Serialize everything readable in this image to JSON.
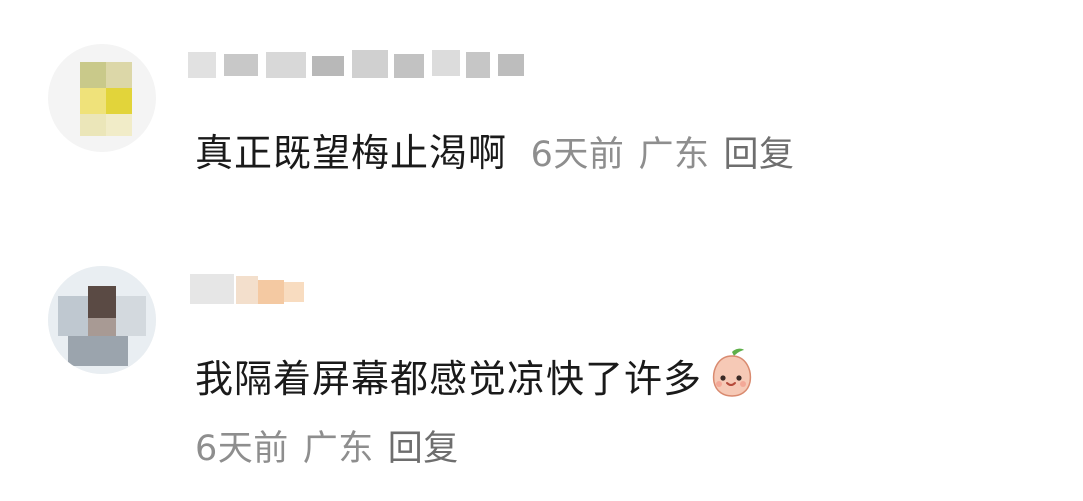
{
  "comments": [
    {
      "text": "真正既望梅止渴啊",
      "time": "6天前",
      "location": "广东",
      "reply_label": "回复"
    },
    {
      "text": "我隔着屏幕都感觉凉快了许多",
      "emoji": "smiling-peach-emoji",
      "time": "6天前",
      "location": "广东",
      "reply_label": "回复"
    }
  ]
}
